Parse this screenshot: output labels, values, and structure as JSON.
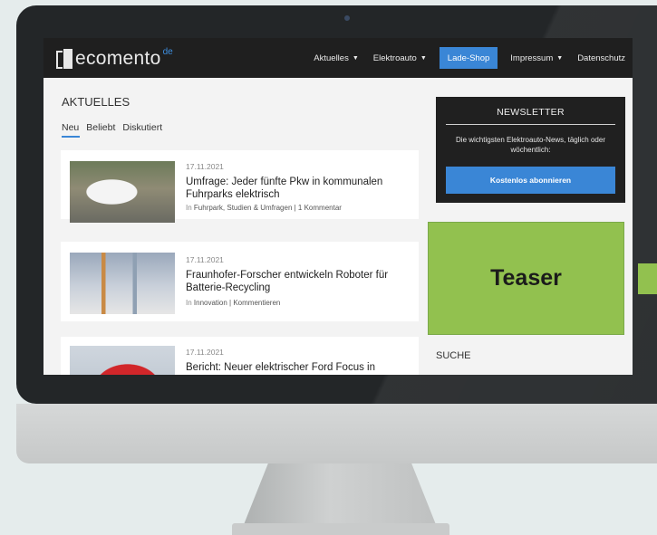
{
  "brand": {
    "name": "ecomento",
    "tld": "de"
  },
  "nav": {
    "items": [
      {
        "label": "Aktuelles",
        "dropdown": true,
        "active": false
      },
      {
        "label": "Elektroauto",
        "dropdown": true,
        "active": false
      },
      {
        "label": "Lade-Shop",
        "dropdown": false,
        "active": true
      },
      {
        "label": "Impressum",
        "dropdown": true,
        "active": false
      },
      {
        "label": "Datenschutz",
        "dropdown": false,
        "active": false
      }
    ],
    "caret": "▼"
  },
  "section": {
    "title": "AKTUELLES",
    "tabs": [
      "Neu",
      "Beliebt",
      "Diskutiert"
    ],
    "active_tab": "Neu"
  },
  "articles": [
    {
      "date": "17.11.2021",
      "headline": "Umfrage: Jeder fünfte Pkw in kommunalen Fuhrparks elektrisch",
      "meta_prefix": "In",
      "meta": "Fuhrpark, Studien & Umfragen | 1 Kommentar"
    },
    {
      "date": "17.11.2021",
      "headline": "Fraunhofer-Forscher entwickeln Roboter für Batterie-Recycling",
      "meta_prefix": "In",
      "meta": "Innovation | Kommentieren"
    },
    {
      "date": "17.11.2021",
      "headline": "Bericht: Neuer elektrischer Ford Focus in Arbeit"
    }
  ],
  "sidebar": {
    "newsletter": {
      "title": "NEWSLETTER",
      "text": "Die wichtigsten Elektroauto-News, täglich oder wöchentlich:",
      "button": "Kostenlos abonnieren"
    },
    "search_title": "SUCHE"
  },
  "teaser": {
    "label": "Teaser"
  },
  "colors": {
    "accent": "#3a86d6",
    "navbar": "#1f1f1f",
    "teaser": "#92c14f"
  }
}
